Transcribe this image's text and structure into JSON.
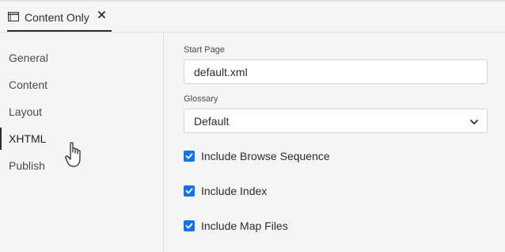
{
  "tab": {
    "title": "Content Only",
    "icon": "window-icon",
    "close_icon": "close-icon"
  },
  "sidebar": {
    "items": [
      {
        "label": "General",
        "active": false
      },
      {
        "label": "Content",
        "active": false
      },
      {
        "label": "Layout",
        "active": false
      },
      {
        "label": "XHTML",
        "active": true
      },
      {
        "label": "Publish",
        "active": false
      }
    ]
  },
  "main": {
    "start_page": {
      "label": "Start Page",
      "value": "default.xml"
    },
    "glossary": {
      "label": "Glossary",
      "value": "Default",
      "icon": "chevron-down-icon"
    },
    "checks": [
      {
        "label": "Include Browse Sequence",
        "checked": true
      },
      {
        "label": "Include Index",
        "checked": true
      },
      {
        "label": "Include Map Files",
        "checked": true
      }
    ]
  },
  "colors": {
    "accent": "#1473e6",
    "background": "#f5f5f5",
    "text": "#2c2c2c"
  }
}
